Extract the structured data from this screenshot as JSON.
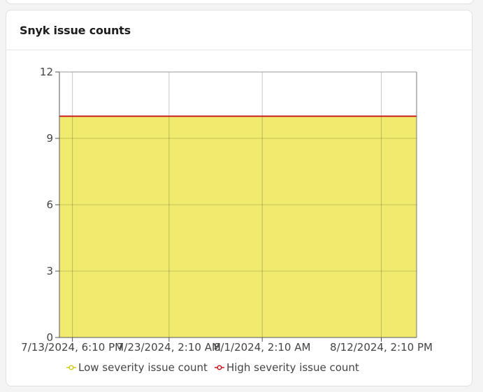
{
  "card": {
    "title": "Snyk issue counts"
  },
  "chart_data": {
    "type": "area",
    "title": "",
    "xlabel": "",
    "ylabel": "",
    "ylim": [
      0,
      12
    ],
    "yticks": [
      0,
      3,
      6,
      9,
      12
    ],
    "xlim": [
      "2024-07-12T12:00",
      "2024-08-16T00:00"
    ],
    "xticks": [
      {
        "x": "2024-07-13T18:10",
        "label": "7/13/2024, 6:10 PM"
      },
      {
        "x": "2024-07-23T02:10",
        "label": "7/23/2024, 2:10 AM"
      },
      {
        "x": "2024-08-01T02:10",
        "label": "8/1/2024, 2:10 AM"
      },
      {
        "x": "2024-08-12T14:10",
        "label": "8/12/2024, 2:10 PM"
      }
    ],
    "grid": true,
    "legend_position": "bottom",
    "series": [
      {
        "name": "Low severity issue count",
        "style": "area",
        "color": "#d4cc1a",
        "fill": "#f0eb6e",
        "x": [
          "2024-07-12T12:00",
          "2024-07-13T18:10",
          "2024-07-23T02:10",
          "2024-08-01T02:10",
          "2024-08-12T14:10",
          "2024-08-16T00:00"
        ],
        "values": [
          10,
          10,
          10,
          10,
          10,
          10
        ]
      },
      {
        "name": "High severity issue count",
        "style": "line",
        "color": "#c8151b",
        "fill": "",
        "x": [
          "2024-07-12T12:00",
          "2024-07-13T18:10",
          "2024-07-23T02:10",
          "2024-08-01T02:10",
          "2024-08-12T14:10",
          "2024-08-16T00:00"
        ],
        "values": [
          10,
          10,
          10,
          10,
          10,
          10
        ]
      }
    ]
  }
}
